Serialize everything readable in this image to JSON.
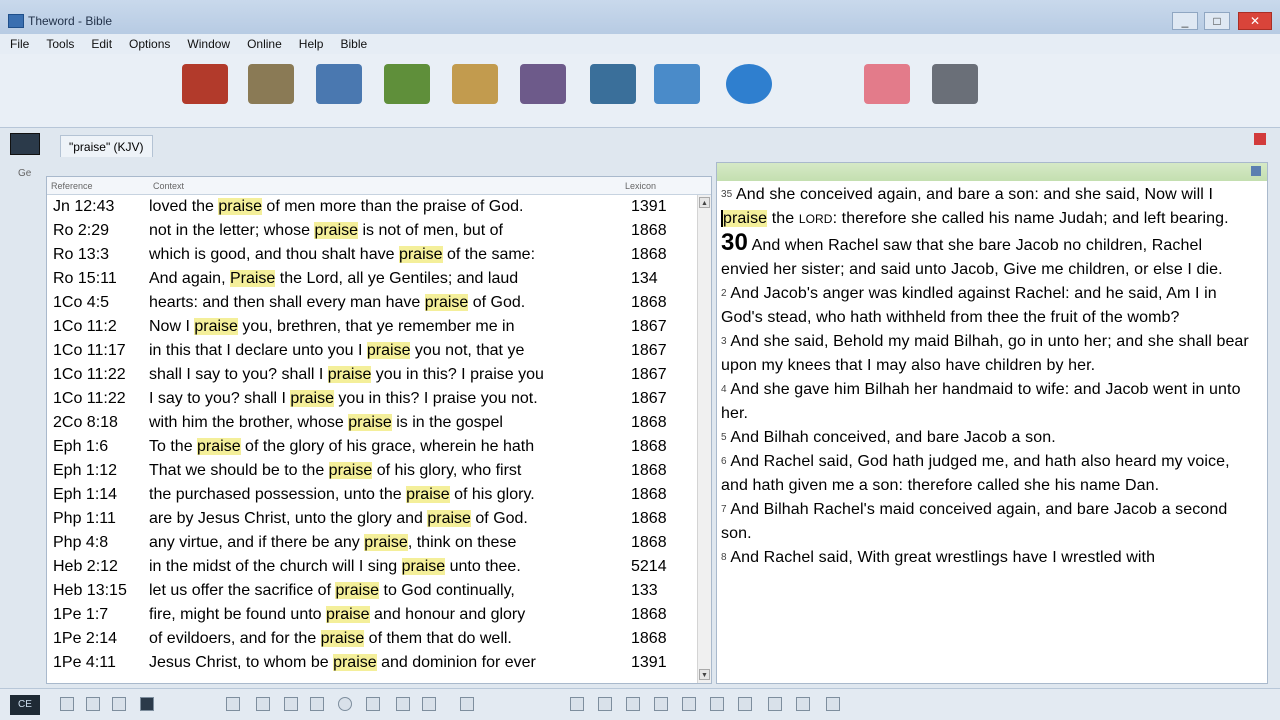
{
  "window": {
    "title": "Theword - Bible",
    "minimize": "_",
    "maximize": "□",
    "close": "✕"
  },
  "menu": [
    "File",
    "Tools",
    "Edit",
    "Options",
    "Window",
    "Online",
    "Help",
    "Bible"
  ],
  "toolbar": [
    {
      "icon": "bible-icon",
      "color": "#b23a2b"
    },
    {
      "icon": "search-icon",
      "color": "#8a7a55"
    },
    {
      "icon": "book-icon",
      "color": "#4a78b0"
    },
    {
      "icon": "green-book-icon",
      "color": "#5f8f3a"
    },
    {
      "icon": "bookshelf-icon",
      "color": "#c29b4e"
    },
    {
      "icon": "books-stack-icon",
      "color": "#6d5a8a"
    },
    {
      "icon": "monitor-icon",
      "color": "#3a6f9a"
    },
    {
      "icon": "document-icon",
      "color": "#4a8bc9"
    },
    {
      "icon": "globe-icon",
      "color": "#2f7fcf"
    },
    {
      "icon": "bookmark-icon",
      "color": "#e37b8a"
    },
    {
      "icon": "settings-icon",
      "color": "#6a6f78"
    }
  ],
  "search_tab": {
    "label": "\"praise\" (KJV)"
  },
  "side_tab": "Ge",
  "results": {
    "headers": {
      "reference": "Reference",
      "context": "Context",
      "lexicon": "Lexicon"
    },
    "rows": [
      {
        "ref": "Jn 12:43",
        "pre": "loved the ",
        "hl": "praise",
        "post": " of men more than the praise of God.",
        "lex": "1391"
      },
      {
        "ref": "Ro 2:29",
        "pre": "not in the letter; whose ",
        "hl": "praise",
        "post": " is not of men, but of",
        "lex": "1868"
      },
      {
        "ref": "Ro 13:3",
        "pre": "which is good, and thou shalt have ",
        "hl": "praise",
        "post": " of the same:",
        "lex": "1868"
      },
      {
        "ref": "Ro 15:11",
        "pre": " And again, ",
        "hl": "Praise",
        "post": " the Lord, all ye Gentiles; and laud",
        "lex": "134"
      },
      {
        "ref": "1Co 4:5",
        "pre": "hearts: and then shall every man have ",
        "hl": "praise",
        "post": " of God.",
        "lex": "1868"
      },
      {
        "ref": "1Co 11:2",
        "pre": " Now I ",
        "hl": "praise",
        "post": " you, brethren, that ye remember me in",
        "lex": "1867"
      },
      {
        "ref": "1Co 11:17",
        "pre": "in this that I declare unto you I ",
        "hl": "praise",
        "post": " you not, that ye",
        "lex": "1867"
      },
      {
        "ref": "1Co 11:22",
        "pre": "shall I say to you? shall I ",
        "hl": "praise",
        "post": " you in this? I praise you",
        "lex": "1867"
      },
      {
        "ref": "1Co 11:22",
        "pre": "I say to you? shall I ",
        "hl": "praise",
        "post": " you in this? I praise you not.",
        "lex": "1867"
      },
      {
        "ref": "2Co 8:18",
        "pre": "with him the brother, whose ",
        "hl": "praise",
        "post": " is in the gospel",
        "lex": "1868"
      },
      {
        "ref": "Eph 1:6",
        "pre": " To the ",
        "hl": "praise",
        "post": " of the glory of his grace, wherein he hath",
        "lex": "1868"
      },
      {
        "ref": "Eph 1:12",
        "pre": " That we should be to the ",
        "hl": "praise",
        "post": " of his glory, who first",
        "lex": "1868"
      },
      {
        "ref": "Eph 1:14",
        "pre": "the purchased possession, unto the ",
        "hl": "praise",
        "post": " of his glory.",
        "lex": "1868"
      },
      {
        "ref": "Php 1:11",
        "pre": "are by Jesus Christ, unto the glory and ",
        "hl": "praise",
        "post": " of God.",
        "lex": "1868"
      },
      {
        "ref": "Php 4:8",
        "pre": "any virtue, and if there be any ",
        "hl": "praise",
        "post": ", think on these",
        "lex": "1868"
      },
      {
        "ref": "Heb 2:12",
        "pre": "in the midst of the church will I sing ",
        "hl": "praise",
        "post": " unto thee.",
        "lex": "5214"
      },
      {
        "ref": "Heb 13:15",
        "pre": "let us offer the sacrifice of ",
        "hl": "praise",
        "post": " to God continually,",
        "lex": "133"
      },
      {
        "ref": "1Pe 1:7",
        "pre": "fire, might be found unto ",
        "hl": "praise",
        "post": " and honour and glory",
        "lex": "1868"
      },
      {
        "ref": "1Pe 2:14",
        "pre": "of evildoers, and for the ",
        "hl": "praise",
        "post": " of them that do well.",
        "lex": "1868"
      },
      {
        "ref": "1Pe 4:11",
        "pre": "Jesus Christ, to whom be ",
        "hl": "praise",
        "post": " and dominion for ever",
        "lex": "1391"
      }
    ]
  },
  "bible": {
    "v35_num": "35",
    "v35_a": "And she conceived again, and bare a son: and she said,",
    "v35_b": "Now will I ",
    "v35_hl": "praise",
    "v35_c": " the ",
    "v35_lord": "LORD",
    "v35_d": ": therefore she called his name",
    "v35_e": "Judah; and left bearing.",
    "v30_num": "30",
    "v30": " And when Rachel saw that she bare Jacob no children, Rachel envied her sister; and said unto Jacob, Give me children, or else I die.",
    "v2_num": "2",
    "v2": " And Jacob's anger was kindled against Rachel: and he said, Am I in God's stead, who hath withheld from thee the fruit of the womb?",
    "v3_num": "3",
    "v3": " And she said, Behold my maid Bilhah, go in unto her; and she shall bear upon my knees that I may also have children by her.",
    "v4_num": "4",
    "v4": " And she gave him Bilhah her handmaid to wife: and Jacob went in unto her.",
    "v5_num": "5",
    "v5": " And Bilhah conceived, and bare Jacob a son.",
    "v6_num": "6",
    "v6": " And Rachel said, God hath judged me, and hath also heard my voice, and hath given me a son: therefore called she his name Dan.",
    "v7_num": "7",
    "v7": " And Bilhah Rachel's maid conceived again, and bare Jacob a second son.",
    "v8_num": "8",
    "v8": " And Rachel said, With great wrestlings have I wrestled with"
  },
  "bottom": {
    "ce_label": "CE"
  }
}
